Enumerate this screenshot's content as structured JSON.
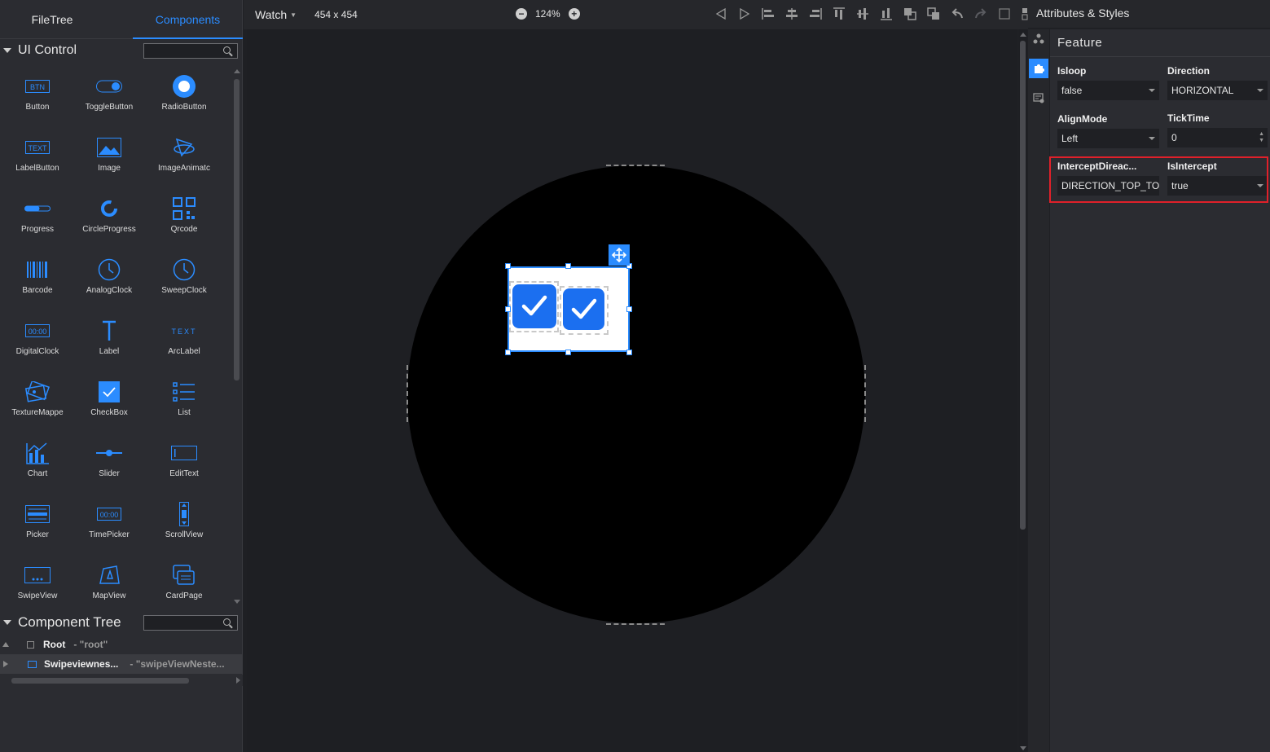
{
  "left_tabs": [
    "FileTree",
    "Components"
  ],
  "ui_control": {
    "title": "UI Control",
    "items": [
      {
        "label": "Button",
        "icon": "button-icon"
      },
      {
        "label": "ToggleButton",
        "icon": "toggle-icon"
      },
      {
        "label": "RadioButton",
        "icon": "radio-icon"
      },
      {
        "label": "LabelButton",
        "icon": "label-button-icon"
      },
      {
        "label": "Image",
        "icon": "image-icon"
      },
      {
        "label": "ImageAnimatc",
        "icon": "image-animator-icon"
      },
      {
        "label": "Progress",
        "icon": "progress-icon"
      },
      {
        "label": "CircleProgress",
        "icon": "circle-progress-icon"
      },
      {
        "label": "Qrcode",
        "icon": "qrcode-icon"
      },
      {
        "label": "Barcode",
        "icon": "barcode-icon"
      },
      {
        "label": "AnalogClock",
        "icon": "analog-clock-icon"
      },
      {
        "label": "SweepClock",
        "icon": "sweep-clock-icon"
      },
      {
        "label": "DigitalClock",
        "icon": "digital-clock-icon"
      },
      {
        "label": "Label",
        "icon": "label-icon"
      },
      {
        "label": "ArcLabel",
        "icon": "arc-label-icon"
      },
      {
        "label": "TextureMappe",
        "icon": "texture-mapper-icon"
      },
      {
        "label": "CheckBox",
        "icon": "checkbox-icon"
      },
      {
        "label": "List",
        "icon": "list-icon"
      },
      {
        "label": "Chart",
        "icon": "chart-icon"
      },
      {
        "label": "Slider",
        "icon": "slider-icon"
      },
      {
        "label": "EditText",
        "icon": "edit-text-icon"
      },
      {
        "label": "Picker",
        "icon": "picker-icon"
      },
      {
        "label": "TimePicker",
        "icon": "time-picker-icon"
      },
      {
        "label": "ScrollView",
        "icon": "scroll-view-icon"
      },
      {
        "label": "SwipeView",
        "icon": "swipe-view-icon"
      },
      {
        "label": "MapView",
        "icon": "map-view-icon"
      },
      {
        "label": "CardPage",
        "icon": "card-page-icon"
      }
    ],
    "icon_text": {
      "btn": "BTN",
      "text": "TEXT",
      "clock": "00:00",
      "arc": "TEXT"
    }
  },
  "component_tree": {
    "title": "Component Tree",
    "rows": [
      {
        "key": "Root",
        "value": "- \"root\""
      },
      {
        "key": "Swipeviewnes...",
        "value": "- \"swipeViewNeste..."
      }
    ]
  },
  "toolbar": {
    "device": "Watch",
    "resolution": "454 x 454",
    "zoom": "124%",
    "zoom_out": "−",
    "zoom_in": "+"
  },
  "right_panel": {
    "title": "Attributes & Styles",
    "section": "Feature",
    "fields": {
      "isloop_label": "Isloop",
      "isloop_value": "false",
      "direction_label": "Direction",
      "direction_value": "HORIZONTAL",
      "alignmode_label": "AlignMode",
      "alignmode_value": "Left",
      "ticktime_label": "TickTime",
      "ticktime_value": "0",
      "intercept_dir_label": "InterceptDireac...",
      "intercept_dir_value": "DIRECTION_TOP_TO",
      "isintercept_label": "IsIntercept",
      "isintercept_value": "true"
    }
  },
  "colors": {
    "accent": "#2b8cff",
    "highlight": "#e0202a",
    "checkbox": "#1b6ff0"
  }
}
